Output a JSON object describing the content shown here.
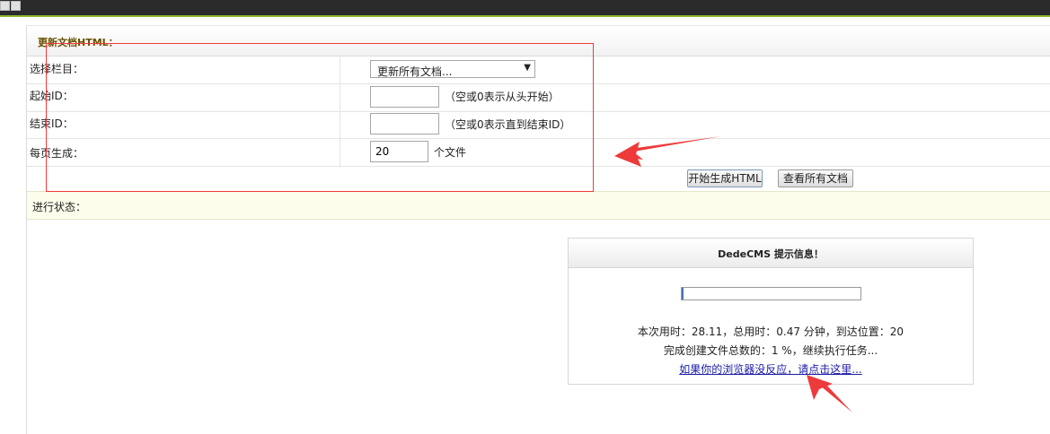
{
  "window": {
    "title": "更新文档HTML："
  },
  "form": {
    "category": {
      "label": "选择栏目：",
      "selected": "更新所有文档..."
    },
    "start_id": {
      "label": "起始ID：",
      "value": "",
      "hint": "（空或0表示从头开始）"
    },
    "end_id": {
      "label": "结束ID：",
      "value": "",
      "hint": "（空或0表示直到结束ID）"
    },
    "per_page": {
      "label": "每页生成：",
      "value": "20",
      "unit": "个文件"
    },
    "buttons": {
      "start": "开始生成HTML",
      "view_all": "查看所有文档"
    }
  },
  "status": {
    "label": "进行状态："
  },
  "message": {
    "title": "DedeCMS 提示信息！",
    "progress_percent": 1,
    "line1": "本次用时：28.11，总用时：0.47 分钟，到达位置：20",
    "line2": "完成创建文件总数的：1 %，继续执行任务...",
    "link": "如果你的浏览器没反应，请点击这里..."
  },
  "annotations": {
    "color": "#ee3a3a"
  }
}
